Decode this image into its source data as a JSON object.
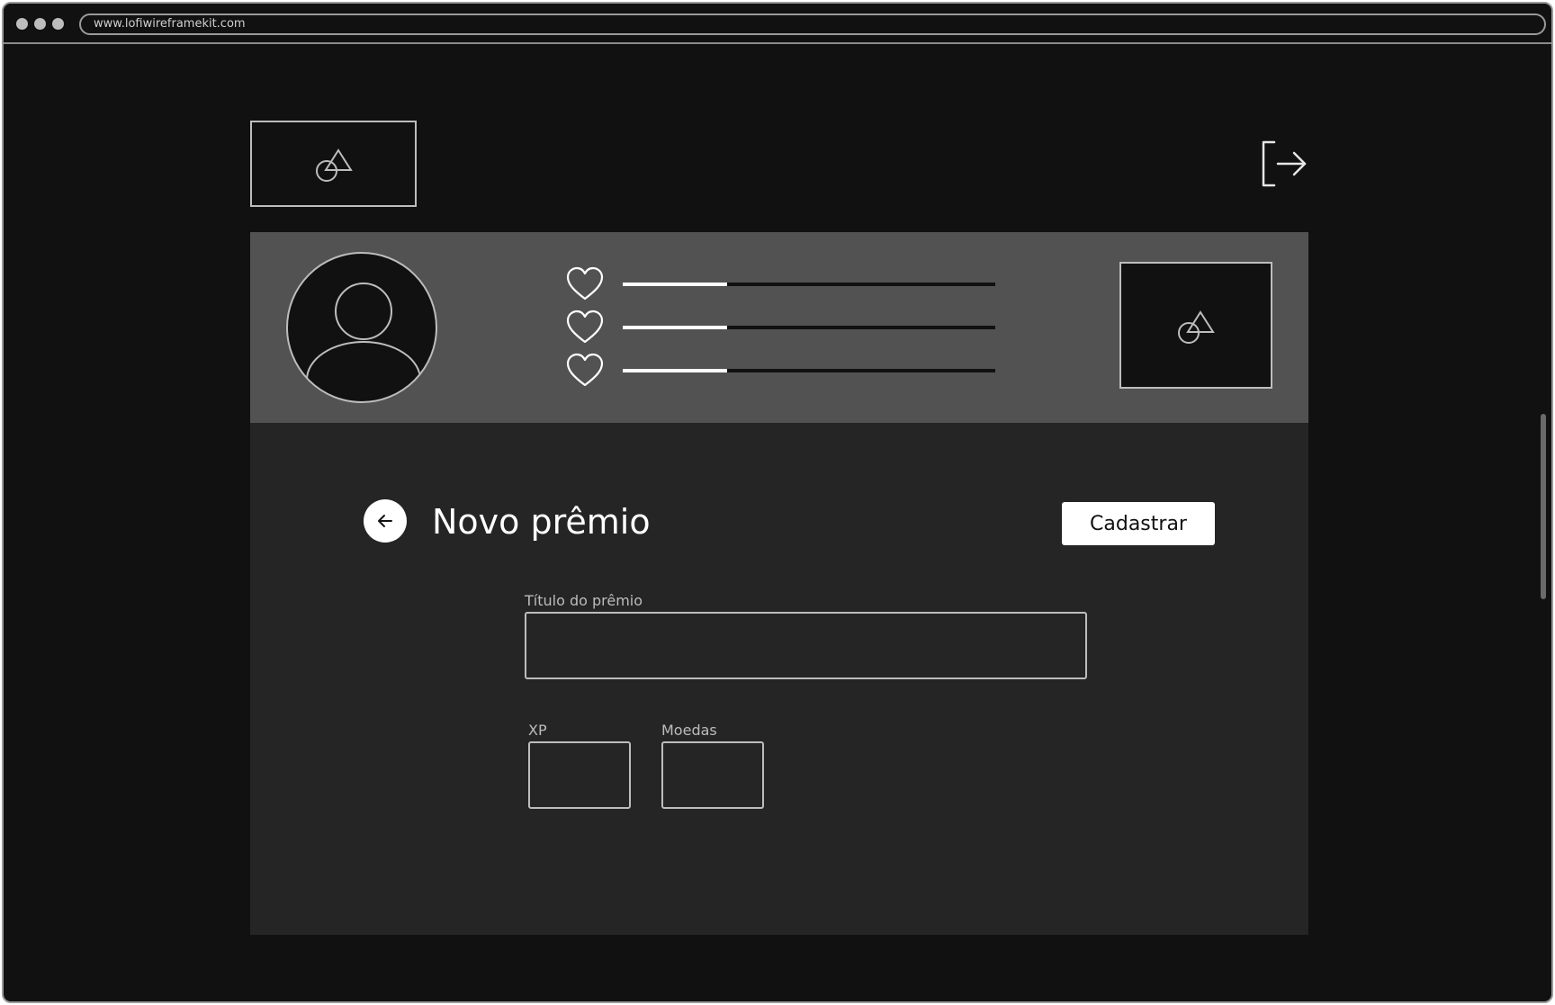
{
  "browser": {
    "url": "www.lofiwireframekit.com"
  },
  "header": {
    "logo_icon": "image-placeholder-icon",
    "logout_icon": "logout-icon"
  },
  "profile": {
    "avatar_icon": "user-avatar-icon",
    "stats": [
      {
        "icon": "heart-icon",
        "progress": 0.28
      },
      {
        "icon": "heart-icon",
        "progress": 0.28
      },
      {
        "icon": "heart-icon",
        "progress": 0.28
      }
    ],
    "side_image_icon": "image-placeholder-icon"
  },
  "form": {
    "back_icon": "arrow-left-icon",
    "title": "Novo prêmio",
    "submit_label": "Cadastrar",
    "fields": {
      "title_label": "Título do prêmio",
      "title_value": "",
      "xp_label": "XP",
      "xp_value": "",
      "coins_label": "Moedas",
      "coins_value": ""
    }
  },
  "colors": {
    "page_bg": "#111111",
    "band_bg": "#525252",
    "panel_bg": "#252525",
    "accent": "#ffffff",
    "outline": "#bdbdbd"
  }
}
